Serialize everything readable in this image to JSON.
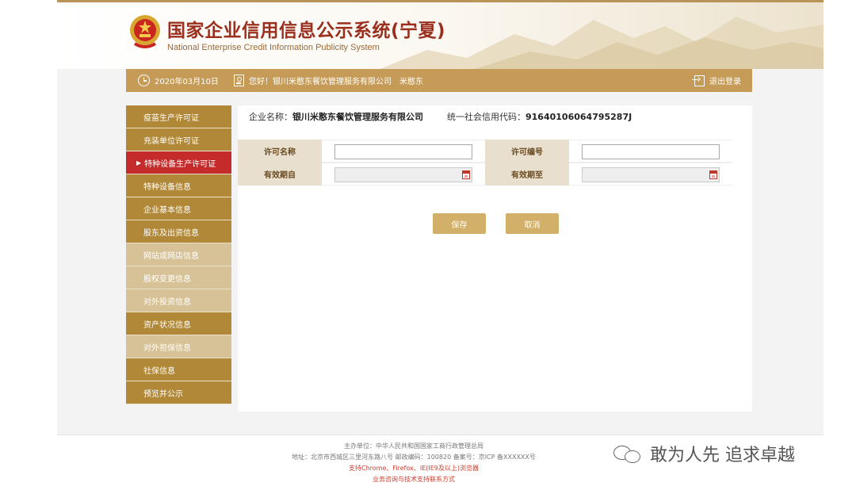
{
  "header": {
    "title": "国家企业信用信息公示系统(宁夏)",
    "subtitle": "National Enterprise Credit Information Publicity System"
  },
  "topbar": {
    "date": "2020年03月10日",
    "greeting": "您好！银川米憨东餐饮管理服务有限公司",
    "username": "米憨东",
    "logout": "退出登录"
  },
  "sidebar": {
    "items": [
      {
        "label": "疫苗生产许可证",
        "style": "dark"
      },
      {
        "label": "充装单位许可证",
        "style": "dark"
      },
      {
        "label": "特种设备生产许可证",
        "style": "active"
      },
      {
        "label": "特种设备信息",
        "style": "dark"
      },
      {
        "label": "企业基本信息",
        "style": "dark"
      },
      {
        "label": "股东及出资信息",
        "style": "dark"
      },
      {
        "label": "网站或网店信息",
        "style": "light"
      },
      {
        "label": "股权变更信息",
        "style": "light"
      },
      {
        "label": "对外投资信息",
        "style": "light"
      },
      {
        "label": "资产状况信息",
        "style": "dark"
      },
      {
        "label": "对外担保信息",
        "style": "light"
      },
      {
        "label": "社保信息",
        "style": "dark"
      },
      {
        "label": "预览并公示",
        "style": "dark"
      }
    ]
  },
  "company": {
    "name_label": "企业名称：",
    "name": "银川米憨东餐饮管理服务有限公司",
    "code_label": "统一社会信用代码：",
    "code": "91640106064795287J"
  },
  "form": {
    "license_name_label": "许可名称",
    "license_name_value": "",
    "license_no_label": "许可编号",
    "license_no_value": "",
    "valid_from_label": "有效期自",
    "valid_to_label": "有效期至"
  },
  "buttons": {
    "save": "保存",
    "cancel": "取消"
  },
  "footer": {
    "line1": "主办单位：中华人民共和国国家工商行政管理总局",
    "line2": "地址：北京市西城区三里河东路八号 邮政编码：100820 备案号：京ICP 备XXXXXX号",
    "line3": "支持Chrome、Firefox、IE(IE9及以上)浏览器",
    "line4": "业务咨询与技术支持联系方式"
  },
  "watermark": {
    "text": "敢为人先 追求卓越"
  },
  "colors": {
    "accent": "#c59b57",
    "sidebar_dark": "#b08838",
    "sidebar_light": "#d6c296",
    "active": "#c62b2b",
    "title": "#9b2f1e"
  }
}
